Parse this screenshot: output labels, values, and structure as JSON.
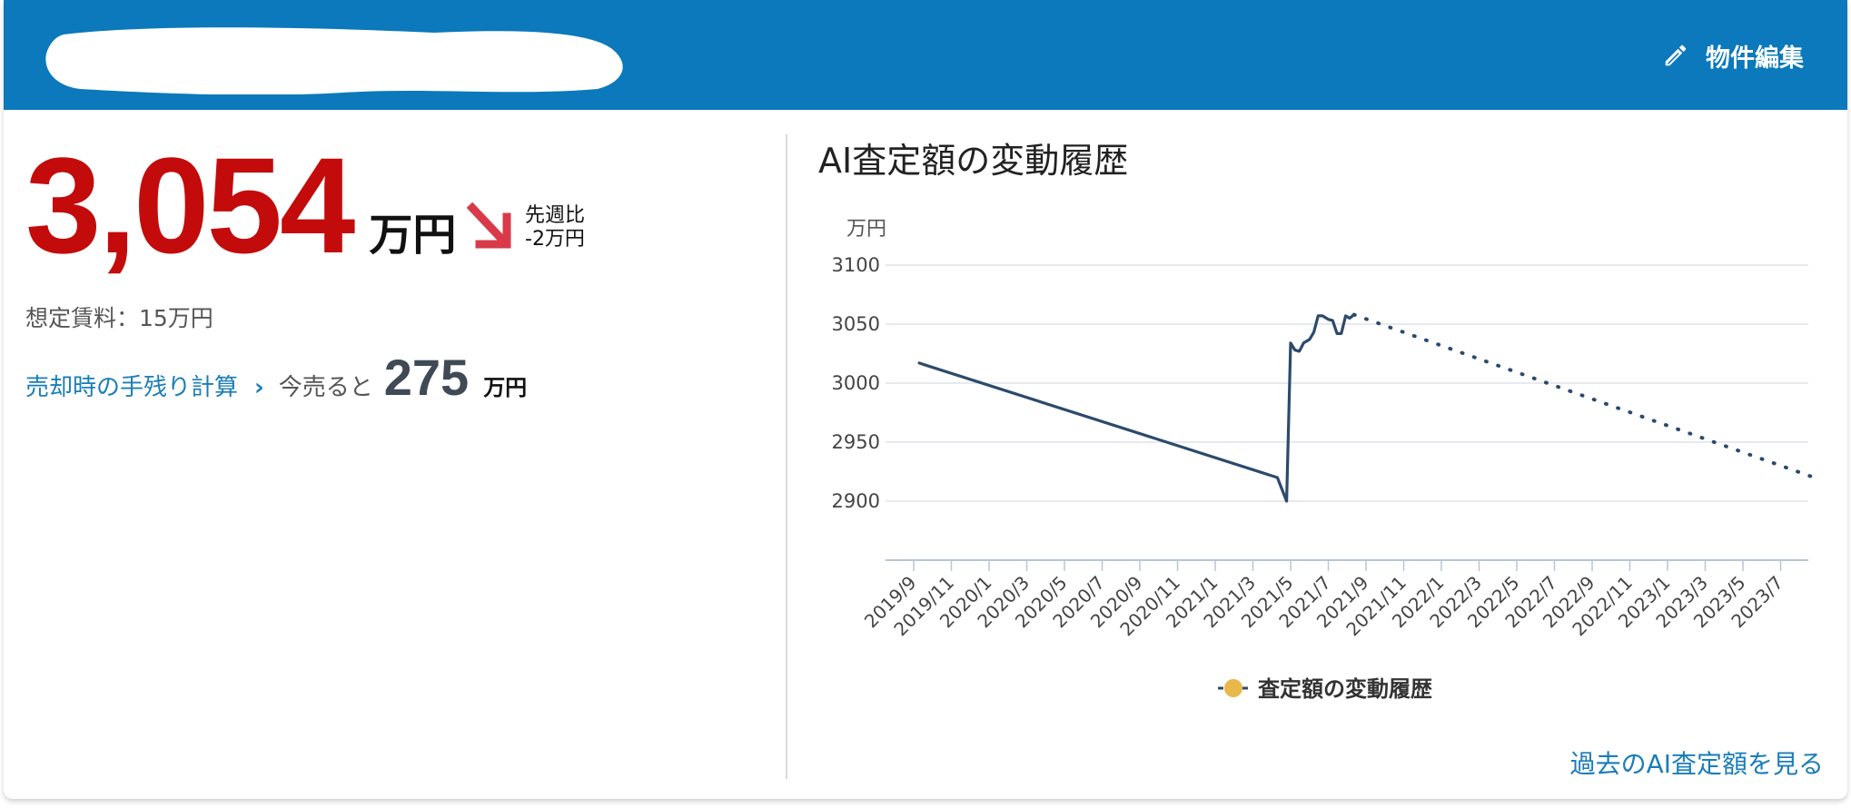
{
  "header": {
    "edit_label": "物件編集",
    "bg_color": "#0b79bb"
  },
  "summary": {
    "price": "3,054",
    "price_unit": "万円",
    "change_label": "先週比",
    "change_value": "-2万円",
    "rent": "想定賃料：15万円",
    "calc_link": "売却時の手残り計算",
    "calc_prefix": "今売ると",
    "calc_value": "275",
    "calc_unit": "万円",
    "accent_red": "#c30b0b"
  },
  "chart": {
    "title": "AI査定額の変動履歴",
    "more_link": "過去のAI査定額を見る"
  },
  "chart_data": {
    "type": "line",
    "ylabel": "万円",
    "ylim": [
      2850,
      3100
    ],
    "yticks": [
      3100,
      3050,
      3000,
      2950,
      2900
    ],
    "x_tick_labels": [
      "2019/9",
      "2019/11",
      "2020/1",
      "2020/3",
      "2020/5",
      "2020/7",
      "2020/9",
      "2020/11",
      "2021/1",
      "2021/3",
      "2021/5",
      "2021/7",
      "2021/9",
      "2021/11",
      "2022/1",
      "2022/3",
      "2022/5",
      "2022/7",
      "2022/9",
      "2022/11",
      "2023/1",
      "2023/3",
      "2023/5",
      "2023/7"
    ],
    "grid": true,
    "legend": "bottom",
    "series": [
      {
        "name": "査定額の変動履歴",
        "style": "solid",
        "color": "#2c4a6b",
        "marker_color": "#e8b84a",
        "points": [
          {
            "x": "2019-09-10",
            "y": 3017
          },
          {
            "x": "2021-04-10",
            "y": 2920
          },
          {
            "x": "2021-04-25",
            "y": 2900
          },
          {
            "x": "2021-05-01",
            "y": 3034
          },
          {
            "x": "2021-05-08",
            "y": 3028
          },
          {
            "x": "2021-05-15",
            "y": 3027
          },
          {
            "x": "2021-05-22",
            "y": 3034
          },
          {
            "x": "2021-06-01",
            "y": 3037
          },
          {
            "x": "2021-06-08",
            "y": 3043
          },
          {
            "x": "2021-06-15",
            "y": 3057
          },
          {
            "x": "2021-06-22",
            "y": 3057
          },
          {
            "x": "2021-07-01",
            "y": 3054
          },
          {
            "x": "2021-07-08",
            "y": 3053
          },
          {
            "x": "2021-07-15",
            "y": 3042
          },
          {
            "x": "2021-07-22",
            "y": 3042
          },
          {
            "x": "2021-07-29",
            "y": 3057
          },
          {
            "x": "2021-08-05",
            "y": 3055
          },
          {
            "x": "2021-08-12",
            "y": 3058
          }
        ]
      },
      {
        "name": "",
        "style": "dotted",
        "color": "#2c4a6b",
        "points": [
          {
            "x": "2021-08-12",
            "y": 3058
          },
          {
            "x": "2023-08-25",
            "y": 2920
          }
        ]
      }
    ]
  }
}
